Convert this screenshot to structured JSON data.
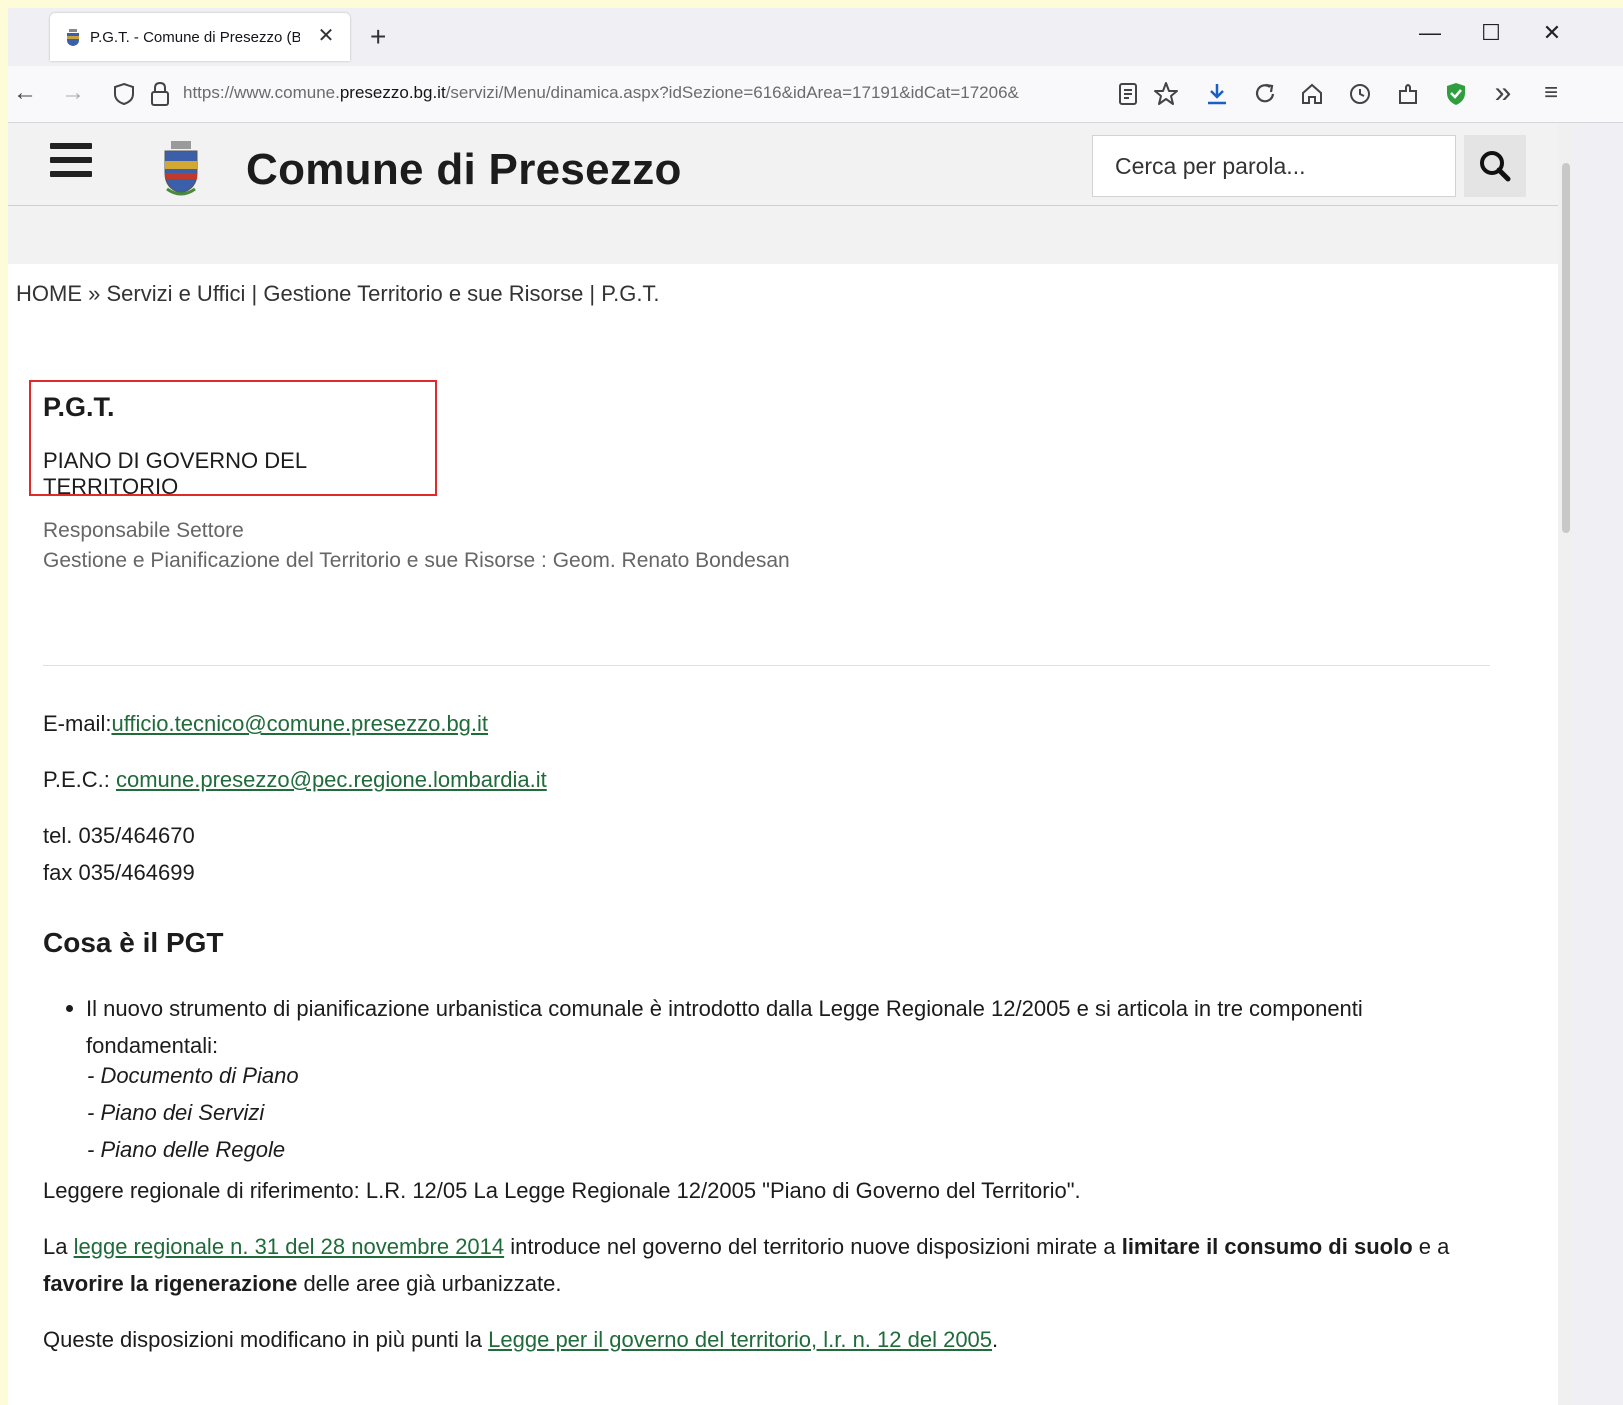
{
  "browser": {
    "tab_title": "P.G.T. - Comune di Presezzo (B",
    "tab_close": "✕",
    "new_tab": "+",
    "minimize": "—",
    "maximize": "☐",
    "close": "✕",
    "back": "←",
    "forward": "→",
    "url_prefix": "https://www.comune.",
    "url_host": "presezzo.bg.it",
    "url_path": "/servizi/Menu/dinamica.aspx?idSezione=616&idArea=17191&idCat=17206&",
    "overflow": "»",
    "menu": "≡"
  },
  "header": {
    "site_name": "Comune di Presezzo",
    "search_placeholder": "Cerca per parola..."
  },
  "breadcrumb": "HOME » Servizi e Uffici | Gestione Territorio e sue Risorse | P.G.T.",
  "title": "P.G.T.",
  "subtitle": "PIANO DI GOVERNO DEL TERRITORIO",
  "responsible": {
    "label": "Responsabile Settore",
    "detail": "Gestione e Pianificazione del Territorio e sue Risorse :  Geom. Renato Bondesan"
  },
  "contacts": {
    "email_label": "E-mail:",
    "email": "ufficio.tecnico@comune.presezzo.bg.it",
    "pec_label": "P.E.C.: ",
    "pec": "comune.presezzo@pec.regione.lombardia.it",
    "tel": "tel. 035/464670",
    "fax": "fax 035/464699"
  },
  "section": {
    "heading": "Cosa è il PGT",
    "bullet": "Il nuovo strumento di pianificazione urbanistica comunale è introdotto dalla Legge Regionale 12/2005 e si articola in tre componenti fondamentali:",
    "items": [
      "- Documento di Piano",
      "- Piano dei Servizi",
      "- Piano delle Regole"
    ],
    "ref": "Leggere regionale di riferimento:  L.R. 12/05  La Legge Regionale 12/2005 \"Piano di Governo del Territorio\".",
    "p2_a": "La ",
    "p2_link": "legge regionale n. 31 del 28 novembre 2014",
    "p2_b": " introduce nel governo del territorio nuove disposizioni mirate a ",
    "p2_bold1": "limitare il consumo di suolo",
    "p2_c": " e a ",
    "p2_bold2": "favorire la rigenerazione",
    "p2_d": " delle aree già urbanizzate.",
    "p3_a": "Queste disposizioni modificano in più punti la ",
    "p3_link": "Legge per il governo del territorio, l.r. n. 12 del 2005",
    "p3_b": "."
  },
  "colors": {
    "link": "#1f6b3a",
    "highlight_box": "#e02a2a",
    "page_background": "#fdfbd8"
  }
}
